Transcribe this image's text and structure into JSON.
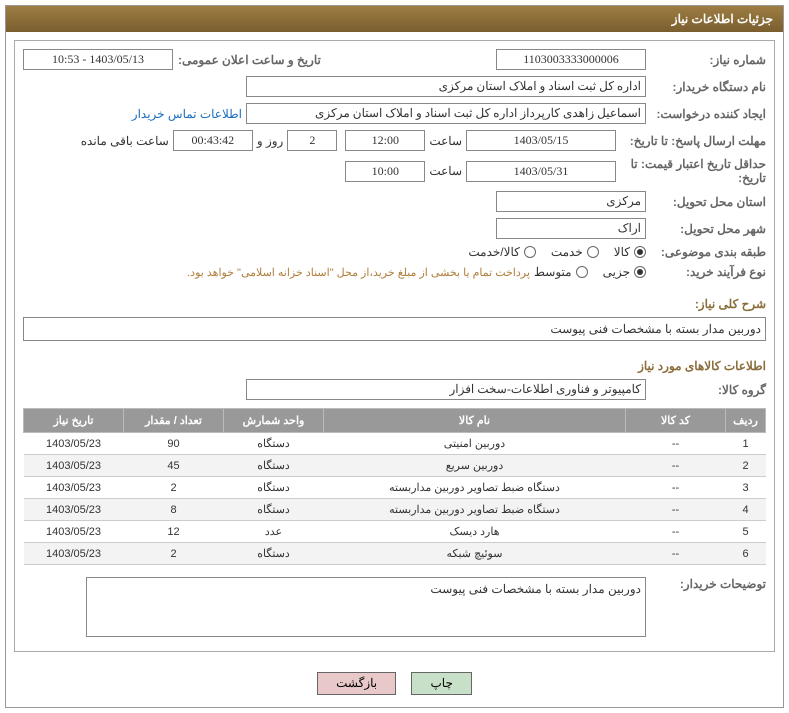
{
  "header": {
    "title": "جزئیات اطلاعات نیاز"
  },
  "labels": {
    "need_no": "شماره نیاز:",
    "announce_time": "تاریخ و ساعت اعلان عمومی:",
    "buyer_org": "نام دستگاه خریدار:",
    "requester": "ایجاد کننده درخواست:",
    "contact": "اطلاعات تماس خریدار",
    "deadline": "مهلت ارسال پاسخ: تا تاریخ:",
    "at": "ساعت",
    "days_and": "روز و",
    "remain": "ساعت باقی مانده",
    "validity": "حداقل تاریخ اعتبار قیمت: تا تاریخ:",
    "province": "استان محل تحویل:",
    "city": "شهر محل تحویل:",
    "category": "طبقه بندی موضوعی:",
    "purchase_type": "نوع فرآیند خرید:",
    "purchase_note": "پرداخت تمام یا بخشی از مبلغ خرید،از محل \"اسناد خزانه اسلامی\" خواهد بود.",
    "overall": "شرح کلی نیاز:",
    "goods_info": "اطلاعات کالاهای مورد نیاز",
    "goods_group": "گروه کالا:",
    "buyer_notes": "توضیحات خریدار:",
    "print": "چاپ",
    "back": "بازگشت"
  },
  "values": {
    "need_no": "1103003333000006",
    "announce_time": "1403/05/13 - 10:53",
    "buyer_org": "اداره کل ثبت اسناد و املاک استان مرکزی",
    "requester": "اسماعیل زاهدی کارپرداز اداره کل ثبت اسناد و املاک استان مرکزی",
    "deadline_date": "1403/05/15",
    "deadline_time": "12:00",
    "days": "2",
    "clock": "00:43:42",
    "validity_date": "1403/05/31",
    "validity_time": "10:00",
    "province": "مرکزی",
    "city": "اراک",
    "overall_desc": "دوربین مدار بسته با مشخصات فنی پیوست",
    "goods_group": "کامپیوتر و فناوری اطلاعات-سخت افزار",
    "buyer_notes": "دوربین مدار بسته با مشخصات فنی پیوست"
  },
  "radios": {
    "category": [
      "کالا",
      "خدمت",
      "کالا/خدمت"
    ],
    "category_sel": 0,
    "purchase": [
      "جزیی",
      "متوسط"
    ],
    "purchase_sel": 0
  },
  "table": {
    "headers": [
      "ردیف",
      "کد کالا",
      "نام کالا",
      "واحد شمارش",
      "تعداد / مقدار",
      "تاریخ نیاز"
    ],
    "rows": [
      {
        "n": "1",
        "code": "--",
        "name": "دوربین امنیتی",
        "unit": "دستگاه",
        "qty": "90",
        "date": "1403/05/23"
      },
      {
        "n": "2",
        "code": "--",
        "name": "دوربین سریع",
        "unit": "دستگاه",
        "qty": "45",
        "date": "1403/05/23"
      },
      {
        "n": "3",
        "code": "--",
        "name": "دستگاه ضبط تصاویر دوربین مداربسته",
        "unit": "دستگاه",
        "qty": "2",
        "date": "1403/05/23"
      },
      {
        "n": "4",
        "code": "--",
        "name": "دستگاه ضبط تصاویر دوربین مداربسته",
        "unit": "دستگاه",
        "qty": "8",
        "date": "1403/05/23"
      },
      {
        "n": "5",
        "code": "--",
        "name": "هارد دیسک",
        "unit": "عدد",
        "qty": "12",
        "date": "1403/05/23"
      },
      {
        "n": "6",
        "code": "--",
        "name": "سوئیچ شبکه",
        "unit": "دستگاه",
        "qty": "2",
        "date": "1403/05/23"
      }
    ]
  }
}
